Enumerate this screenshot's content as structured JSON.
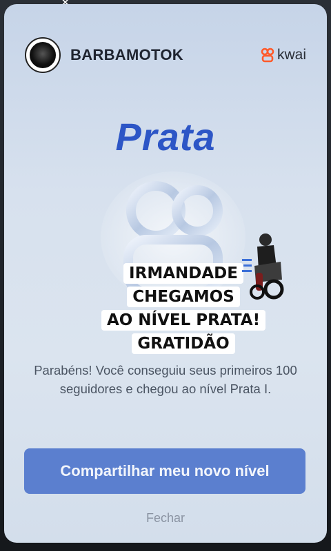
{
  "profile": {
    "username": "BARBAMOTOK"
  },
  "brand": {
    "name": "kwai",
    "color": "#ff5a2a"
  },
  "level": {
    "title": "Prata",
    "title_color": "#2d56c6"
  },
  "overlay_caption": {
    "lines": [
      "IRMANDADE",
      "CHEGAMOS",
      "AO NÍVEL PRATA!",
      "GRATIDÃO"
    ]
  },
  "message": {
    "text": "Parabéns! Você conseguiu seus primeiros 100 seguidores e chegou ao nível Prata I."
  },
  "actions": {
    "share_label": "Compartilhar meu novo nível",
    "close_label": "Fechar"
  },
  "colors": {
    "primary_button": "#5b7fcf"
  },
  "icons": {
    "close": "close-icon",
    "logo": "kwai-logo-icon",
    "badge": "silver-level-badge-icon",
    "sticker": "motorcycle-rider-sticker"
  }
}
